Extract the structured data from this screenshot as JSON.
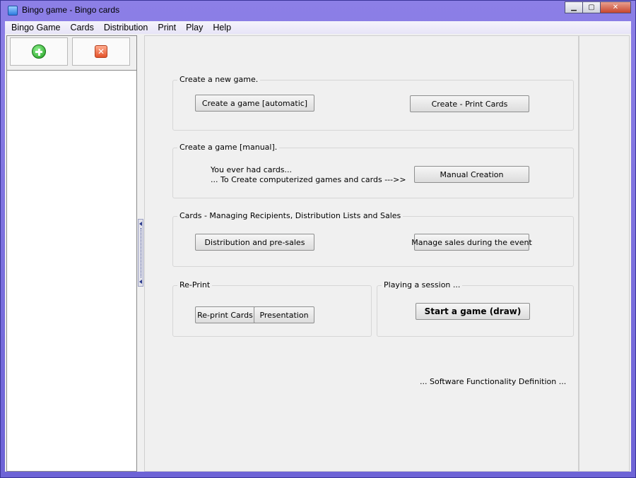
{
  "window": {
    "title": "Bingo game - Bingo cards",
    "controls": {
      "minimize": "▁",
      "maximize": "▢",
      "close": "✕"
    }
  },
  "menu": [
    "Bingo Game",
    "Cards",
    "Distribution",
    "Print",
    "Play",
    "Help"
  ],
  "left_toolbar": {
    "add_icon": "plus-circle-icon",
    "delete_icon": "delete-x-icon",
    "delete_glyph": "✕"
  },
  "groups": {
    "new_game": {
      "label": "Create a new game.",
      "btn_auto": "Create a game [automatic]",
      "btn_print": "Create - Print Cards"
    },
    "manual": {
      "label": "Create a game [manual].",
      "line1": "You ever had cards...",
      "line2": "... To Create computerized games and cards --->>",
      "btn_manual": "Manual Creation"
    },
    "cards": {
      "label": "Cards - Managing Recipients, Distribution Lists and Sales",
      "btn_distribution": "Distribution and pre-sales",
      "btn_manage": "Manage sales during the event"
    },
    "reprint": {
      "label": "Re-Print",
      "btn_reprint": "Re-print Cards",
      "btn_presentation": "Presentation"
    },
    "session": {
      "label": "Playing a session  ...",
      "btn_start": "Start a game (draw)"
    }
  },
  "footer_text": "... Software Functionality Definition ..."
}
